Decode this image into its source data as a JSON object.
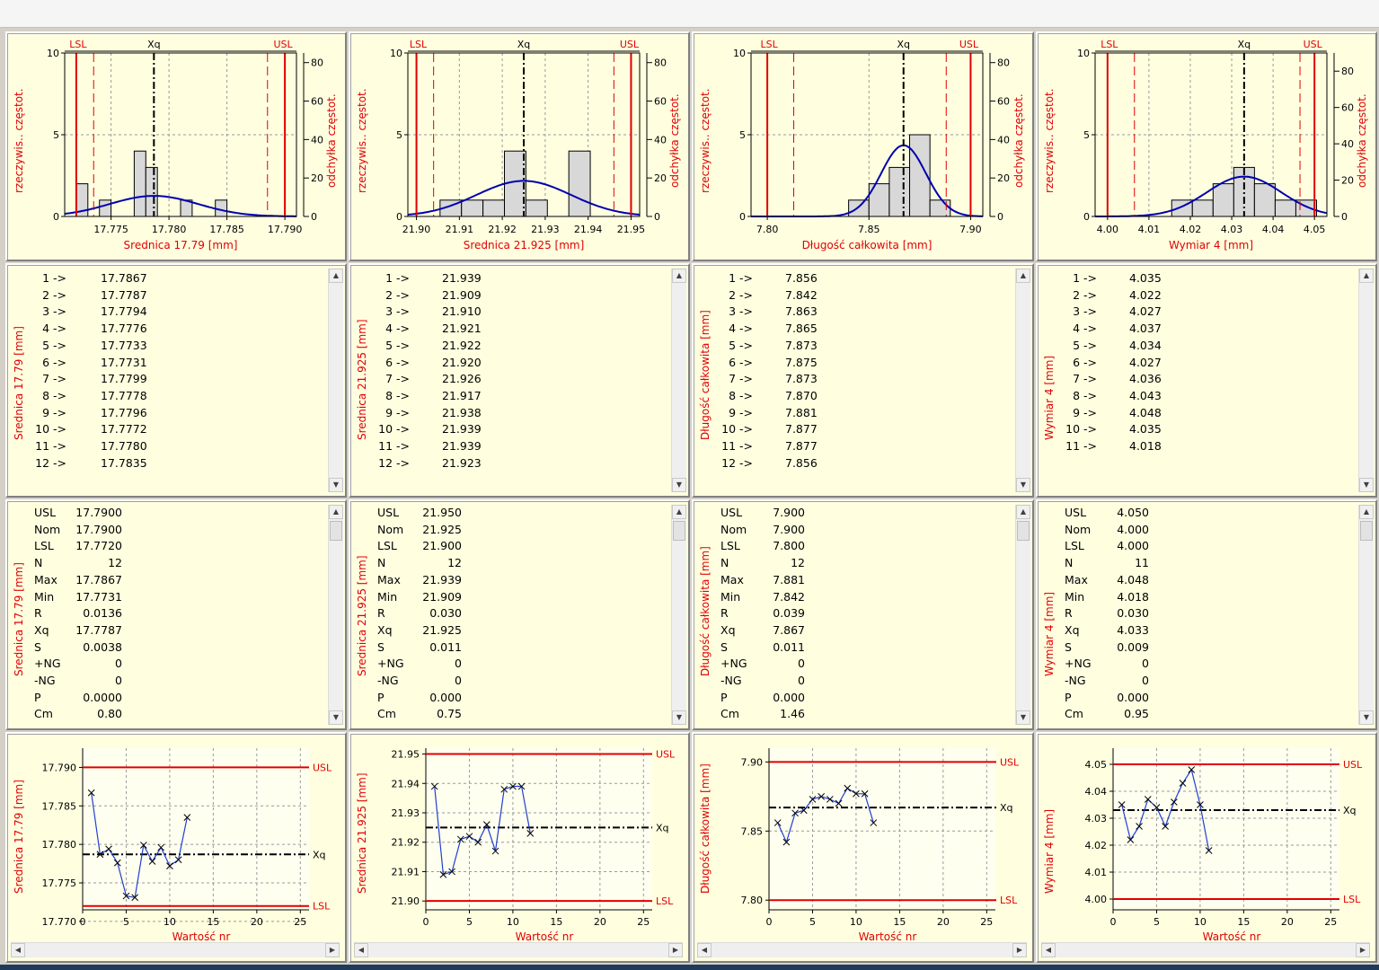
{
  "colors": {
    "spec": "#e00000",
    "curve": "#0000b0",
    "panel_bg": "#ffffe0",
    "bar_fill": "#d8d8d8",
    "run_line": "#1f3fd0"
  },
  "columns": [
    {
      "title": "Srednica 17.79 [mm]",
      "hist": {
        "xlabel": "Srednica 17.79 [mm]",
        "yleft_label": "rzeczywis.. częstot.",
        "yright_label": "odchyłka częstot.",
        "xmin": 17.771,
        "xmax": 17.791,
        "xticks": [
          "17.775",
          "17.780",
          "17.785",
          "17.790"
        ],
        "xtick_values": [
          17.775,
          17.78,
          17.785,
          17.79
        ],
        "usl": 17.79,
        "lsl": 17.772,
        "xq": 17.7787,
        "inner_lower": 17.7735,
        "inner_upper": 17.7885,
        "bin_width": 0.001,
        "bins_left": [
          17.772,
          17.774,
          17.777,
          17.778,
          17.781,
          17.784
        ],
        "counts": [
          2,
          1,
          4,
          3,
          1,
          1
        ],
        "sd": 0.0038,
        "right_ticks": [
          "80",
          "60",
          "40",
          "20",
          "0"
        ],
        "right_values": [
          80,
          60,
          40,
          20,
          0
        ],
        "right_max": 85,
        "left_ticks": [
          "10",
          "5",
          "0"
        ]
      },
      "list": [
        "17.7867",
        "17.7787",
        "17.7794",
        "17.7776",
        "17.7733",
        "17.7731",
        "17.7799",
        "17.7778",
        "17.7796",
        "17.7772",
        "17.7780",
        "17.7835"
      ],
      "stats": {
        "USL": "17.7900",
        "Nom": "17.7900",
        "LSL": "17.7720",
        "N": "12",
        "Max": "17.7867",
        "Min": "17.7731",
        "R": "0.0136",
        "Xq": "17.7787",
        "S": "0.0038",
        "+NG": "0",
        "-NG": "0",
        "P": "0.0000",
        "Cm": "0.80"
      },
      "run": {
        "ymin": 17.7715,
        "ymax": 17.7925,
        "yticks": [
          "17.790",
          "17.785",
          "17.780",
          "17.775",
          "17.770"
        ],
        "ytick_values": [
          17.79,
          17.785,
          17.78,
          17.775,
          17.77
        ],
        "usl": 17.79,
        "lsl": 17.772,
        "xq": 17.7787,
        "values": [
          17.7867,
          17.7787,
          17.7794,
          17.7776,
          17.7733,
          17.7731,
          17.7799,
          17.7778,
          17.7796,
          17.7772,
          17.778,
          17.7835
        ]
      }
    },
    {
      "title": "Srednica 21.925 [mm]",
      "hist": {
        "xlabel": "Srednica 21.925 [mm]",
        "yleft_label": "rzeczywis.. częstot.",
        "yright_label": "odchyłka częstot.",
        "xmin": 21.898,
        "xmax": 21.952,
        "xticks": [
          "21.90",
          "21.91",
          "21.92",
          "21.93",
          "21.94",
          "21.95"
        ],
        "xtick_values": [
          21.9,
          21.91,
          21.92,
          21.93,
          21.94,
          21.95
        ],
        "usl": 21.95,
        "lsl": 21.9,
        "xq": 21.925,
        "inner_lower": 21.904,
        "inner_upper": 21.946,
        "bin_width": 0.005,
        "bins_left": [
          21.9055,
          21.9105,
          21.9155,
          21.9205,
          21.9255,
          21.9355
        ],
        "counts": [
          1,
          1,
          1,
          4,
          1,
          4
        ],
        "sd": 0.011,
        "right_ticks": [
          "80",
          "60",
          "40",
          "20",
          "0"
        ],
        "right_values": [
          80,
          60,
          40,
          20,
          0
        ],
        "right_max": 85,
        "left_ticks": [
          "10",
          "5",
          "0"
        ]
      },
      "list": [
        "21.939",
        "21.909",
        "21.910",
        "21.921",
        "21.922",
        "21.920",
        "21.926",
        "21.917",
        "21.938",
        "21.939",
        "21.939",
        "21.923"
      ],
      "stats": {
        "USL": "21.950",
        "Nom": "21.925",
        "LSL": "21.900",
        "N": "12",
        "Max": "21.939",
        "Min": "21.909",
        "R": "0.030",
        "Xq": "21.925",
        "S": "0.011",
        "+NG": "0",
        "-NG": "0",
        "P": "0.000",
        "Cm": "0.75"
      },
      "run": {
        "ymin": 21.897,
        "ymax": 21.952,
        "yticks": [
          "21.95",
          "21.94",
          "21.93",
          "21.92",
          "21.91",
          "21.90"
        ],
        "ytick_values": [
          21.95,
          21.94,
          21.93,
          21.92,
          21.91,
          21.9
        ],
        "usl": 21.95,
        "lsl": 21.9,
        "xq": 21.925,
        "values": [
          21.939,
          21.909,
          21.91,
          21.921,
          21.922,
          21.92,
          21.926,
          21.917,
          21.938,
          21.939,
          21.939,
          21.923
        ]
      }
    },
    {
      "title": "Długość całkowita [mm]",
      "hist": {
        "xlabel": "Długość całkowita [mm]",
        "yleft_label": "rzeczywis.. częstot.",
        "yright_label": "odchyłka częstot.",
        "xmin": 7.792,
        "xmax": 7.906,
        "xticks": [
          "7.80",
          "7.85",
          "7.90"
        ],
        "xtick_values": [
          7.8,
          7.85,
          7.9
        ],
        "usl": 7.9,
        "lsl": 7.8,
        "xq": 7.867,
        "inner_lower": 7.813,
        "inner_upper": 7.888,
        "bin_width": 0.01,
        "bins_left": [
          7.84,
          7.85,
          7.86,
          7.87,
          7.88
        ],
        "counts": [
          1,
          2,
          3,
          5,
          1
        ],
        "sd": 0.011,
        "right_ticks": [
          "80",
          "60",
          "40",
          "20",
          "0"
        ],
        "right_values": [
          80,
          60,
          40,
          20,
          0
        ],
        "right_max": 85,
        "left_ticks": [
          "10",
          "5",
          "0"
        ]
      },
      "list": [
        "7.856",
        "7.842",
        "7.863",
        "7.865",
        "7.873",
        "7.875",
        "7.873",
        "7.870",
        "7.881",
        "7.877",
        "7.877",
        "7.856"
      ],
      "stats": {
        "USL": "7.900",
        "Nom": "7.900",
        "LSL": "7.800",
        "N": "12",
        "Max": "7.881",
        "Min": "7.842",
        "R": "0.039",
        "Xq": "7.867",
        "S": "0.011",
        "+NG": "0",
        "-NG": "0",
        "P": "0.000",
        "Cm": "1.46"
      },
      "run": {
        "ymin": 7.793,
        "ymax": 7.91,
        "yticks": [
          "7.90",
          "7.85",
          "7.80"
        ],
        "ytick_values": [
          7.9,
          7.85,
          7.8
        ],
        "usl": 7.9,
        "lsl": 7.8,
        "xq": 7.867,
        "values": [
          7.856,
          7.842,
          7.863,
          7.865,
          7.873,
          7.875,
          7.873,
          7.87,
          7.881,
          7.877,
          7.877,
          7.856
        ]
      }
    },
    {
      "title": "Wymiar 4 [mm]",
      "hist": {
        "xlabel": "Wymiar 4 [mm]",
        "yleft_label": "rzeczywis.. częstot.",
        "yright_label": "odchyłka częstot.",
        "xmin": 3.997,
        "xmax": 4.053,
        "xticks": [
          "4.00",
          "4.01",
          "4.02",
          "4.03",
          "4.04",
          "4.05"
        ],
        "xtick_values": [
          4.0,
          4.01,
          4.02,
          4.03,
          4.04,
          4.05
        ],
        "usl": 4.05,
        "lsl": 4.0,
        "xq": 4.033,
        "inner_lower": 4.0065,
        "inner_upper": 4.0465,
        "bin_width": 0.005,
        "bins_left": [
          4.0155,
          4.0205,
          4.0255,
          4.0305,
          4.0355,
          4.0405,
          4.0455
        ],
        "counts": [
          1,
          1,
          2,
          3,
          2,
          1,
          1
        ],
        "sd": 0.009,
        "right_ticks": [
          "80",
          "60",
          "40",
          "20",
          "0"
        ],
        "right_values": [
          80,
          60,
          40,
          20,
          0
        ],
        "right_max": 90,
        "left_ticks": [
          "10",
          "5",
          "0"
        ]
      },
      "list": [
        "4.035",
        "4.022",
        "4.027",
        "4.037",
        "4.034",
        "4.027",
        "4.036",
        "4.043",
        "4.048",
        "4.035",
        "4.018"
      ],
      "stats": {
        "USL": "4.050",
        "Nom": "4.000",
        "LSL": "4.000",
        "N": "11",
        "Max": "4.048",
        "Min": "4.018",
        "R": "0.030",
        "Xq": "4.033",
        "S": "0.009",
        "+NG": "0",
        "-NG": "0",
        "P": "0.000",
        "Cm": "0.95"
      },
      "run": {
        "ymin": 3.996,
        "ymax": 4.056,
        "yticks": [
          "4.05",
          "4.04",
          "4.03",
          "4.02",
          "4.01",
          "4.00"
        ],
        "ytick_values": [
          4.05,
          4.04,
          4.03,
          4.02,
          4.01,
          4.0
        ],
        "usl": 4.05,
        "lsl": 4.0,
        "xq": 4.033,
        "values": [
          4.035,
          4.022,
          4.027,
          4.037,
          4.034,
          4.027,
          4.036,
          4.043,
          4.048,
          4.035,
          4.018
        ]
      }
    }
  ],
  "labels": {
    "usl": "USL",
    "lsl": "LSL",
    "xq": "Xq",
    "run_xlabel": "Wartość nr",
    "run_xticks": [
      "0",
      "5",
      "10",
      "15",
      "20",
      "25"
    ],
    "stat_keys": [
      "USL",
      "Nom",
      "LSL",
      "N",
      "Max",
      "Min",
      "R",
      "Xq",
      "S",
      "+NG",
      "-NG",
      "P",
      "Cm"
    ]
  },
  "chart_data": [
    {
      "type": "bar",
      "title": "",
      "xlabel": "Srednica 17.79 [mm]",
      "ylabel": "rzeczywis.. częstot.",
      "y2label": "odchyłka częstot.",
      "categories": [
        "17.772",
        "17.774",
        "17.777",
        "17.778",
        "17.781",
        "17.784"
      ],
      "values": [
        2,
        1,
        4,
        3,
        1,
        1
      ],
      "ylim": [
        0,
        10
      ],
      "y2lim": [
        0,
        85
      ],
      "usl": 17.79,
      "lsl": 17.772,
      "xq": 17.7787
    },
    {
      "type": "bar",
      "title": "",
      "xlabel": "Srednica 21.925 [mm]",
      "ylabel": "rzeczywis.. częstot.",
      "y2label": "odchyłka częstot.",
      "categories": [
        "21.9055",
        "21.9105",
        "21.9155",
        "21.9205",
        "21.9255",
        "21.9355"
      ],
      "values": [
        1,
        1,
        1,
        4,
        1,
        4
      ],
      "ylim": [
        0,
        10
      ],
      "y2lim": [
        0,
        85
      ],
      "usl": 21.95,
      "lsl": 21.9,
      "xq": 21.925
    },
    {
      "type": "bar",
      "title": "",
      "xlabel": "Długość całkowita [mm]",
      "ylabel": "rzeczywis.. częstot.",
      "y2label": "odchyłka częstot.",
      "categories": [
        "7.84",
        "7.85",
        "7.86",
        "7.87",
        "7.88"
      ],
      "values": [
        1,
        2,
        3,
        5,
        1
      ],
      "ylim": [
        0,
        10
      ],
      "y2lim": [
        0,
        85
      ],
      "usl": 7.9,
      "lsl": 7.8,
      "xq": 7.867
    },
    {
      "type": "bar",
      "title": "",
      "xlabel": "Wymiar 4 [mm]",
      "ylabel": "rzeczywis.. częstot.",
      "y2label": "odchyłka częstot.",
      "categories": [
        "4.0155",
        "4.0205",
        "4.0255",
        "4.0305",
        "4.0355",
        "4.0405",
        "4.0455"
      ],
      "values": [
        1,
        1,
        2,
        3,
        2,
        1,
        1
      ],
      "ylim": [
        0,
        10
      ],
      "y2lim": [
        0,
        90
      ],
      "usl": 4.05,
      "lsl": 4.0,
      "xq": 4.033
    },
    {
      "type": "line",
      "title": "",
      "xlabel": "Wartość nr",
      "ylabel": "Srednica 17.79 [mm]",
      "x": [
        1,
        2,
        3,
        4,
        5,
        6,
        7,
        8,
        9,
        10,
        11,
        12
      ],
      "values": [
        17.7867,
        17.7787,
        17.7794,
        17.7776,
        17.7733,
        17.7731,
        17.7799,
        17.7778,
        17.7796,
        17.7772,
        17.778,
        17.7835
      ],
      "ylim": [
        17.7715,
        17.7925
      ],
      "xlim": [
        0,
        26
      ],
      "usl": 17.79,
      "lsl": 17.772,
      "xq": 17.7787
    },
    {
      "type": "line",
      "title": "",
      "xlabel": "Wartość nr",
      "ylabel": "Srednica 21.925 [mm]",
      "x": [
        1,
        2,
        3,
        4,
        5,
        6,
        7,
        8,
        9,
        10,
        11,
        12
      ],
      "values": [
        21.939,
        21.909,
        21.91,
        21.921,
        21.922,
        21.92,
        21.926,
        21.917,
        21.938,
        21.939,
        21.939,
        21.923
      ],
      "ylim": [
        21.897,
        21.952
      ],
      "xlim": [
        0,
        26
      ],
      "usl": 21.95,
      "lsl": 21.9,
      "xq": 21.925
    },
    {
      "type": "line",
      "title": "",
      "xlabel": "Wartość nr",
      "ylabel": "Długość całkowita [mm]",
      "x": [
        1,
        2,
        3,
        4,
        5,
        6,
        7,
        8,
        9,
        10,
        11,
        12
      ],
      "values": [
        7.856,
        7.842,
        7.863,
        7.865,
        7.873,
        7.875,
        7.873,
        7.87,
        7.881,
        7.877,
        7.877,
        7.856
      ],
      "ylim": [
        7.793,
        7.91
      ],
      "xlim": [
        0,
        26
      ],
      "usl": 7.9,
      "lsl": 7.8,
      "xq": 7.867
    },
    {
      "type": "line",
      "title": "",
      "xlabel": "Wartość nr",
      "ylabel": "Wymiar 4 [mm]",
      "x": [
        1,
        2,
        3,
        4,
        5,
        6,
        7,
        8,
        9,
        10,
        11
      ],
      "values": [
        4.035,
        4.022,
        4.027,
        4.037,
        4.034,
        4.027,
        4.036,
        4.043,
        4.048,
        4.035,
        4.018
      ],
      "ylim": [
        3.996,
        4.056
      ],
      "xlim": [
        0,
        26
      ],
      "usl": 4.05,
      "lsl": 4.0,
      "xq": 4.033
    }
  ]
}
